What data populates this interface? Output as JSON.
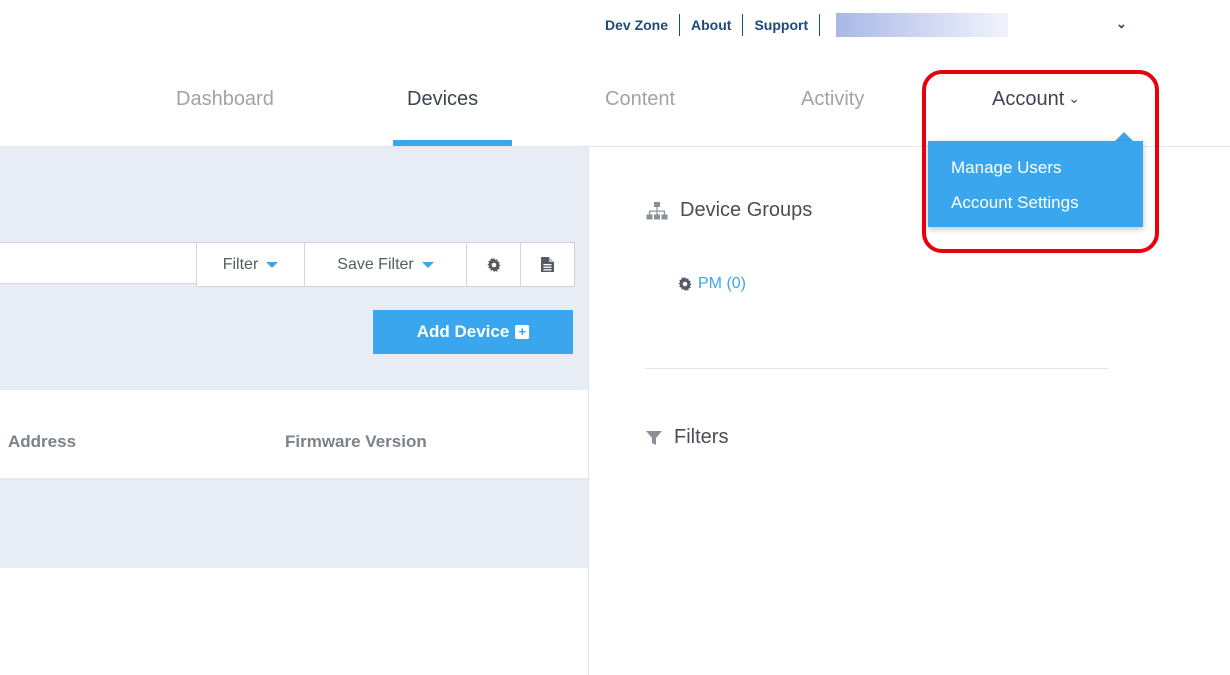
{
  "util_bar": {
    "links": [
      "Dev Zone",
      "About",
      "Support"
    ],
    "user_caret": "⌄"
  },
  "nav": {
    "tabs": [
      "Dashboard",
      "Devices",
      "Content",
      "Activity",
      "Account"
    ],
    "active_tab": "Devices",
    "account_chevron": "⌄"
  },
  "toolbar": {
    "search_value": "",
    "filter_label": "Filter",
    "save_filter_label": "Save Filter",
    "add_device_label": "Add Device"
  },
  "table": {
    "columns": [
      "Address",
      "Firmware Version"
    ]
  },
  "right_panel": {
    "device_groups_title": "Device Groups",
    "groups": [
      {
        "label": "PM (0)"
      }
    ],
    "filters_title": "Filters"
  },
  "account_menu": {
    "items": [
      "Manage Users",
      "Account Settings"
    ]
  },
  "colors": {
    "accent": "#3aa6ee",
    "highlight": "#e8000b",
    "toolbar_bg": "#e8edf5",
    "util_text": "#1e4a7a"
  }
}
